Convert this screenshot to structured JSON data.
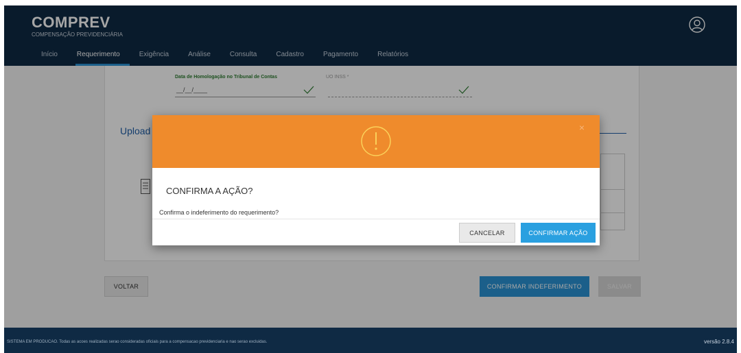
{
  "header": {
    "app_title": "COMPREV",
    "app_subtitle": "COMPENSAÇÃO PREVIDENCIÁRIA",
    "nav": [
      {
        "label": "Início"
      },
      {
        "label": "Requerimento"
      },
      {
        "label": "Exigência"
      },
      {
        "label": "Análise"
      },
      {
        "label": "Consulta"
      },
      {
        "label": "Cadastro"
      },
      {
        "label": "Pagamento"
      },
      {
        "label": "Relatórios"
      }
    ],
    "active_nav": "Requerimento",
    "user_icon": "user-icon"
  },
  "form": {
    "date_label": "Data de Homologação no Tribunal de Contas",
    "date_value": "__/__/____",
    "uo_label": "UO INSS *",
    "upload_title": "Upload"
  },
  "actions": {
    "back_label": "VOLTAR",
    "confirm_reject_label": "CONFIRMAR INDEFERIMENTO",
    "save_label": "SALVAR"
  },
  "modal": {
    "icon": "warning-icon",
    "close_symbol": "×",
    "title": "CONFIRMA A AÇÃO?",
    "message": "Confirma o indeferimento do requerimento?",
    "cancel_label": "CANCELAR",
    "confirm_label": "CONFIRMAR AÇÃO"
  },
  "footer": {
    "notice": "SISTEMA EM PRODUCAO. Todas as acoes realizadas serao consideradas oficiais para a compensacao previdenciaria e nao serao excluidas.",
    "version": "versão 2.8.4"
  },
  "colors": {
    "header_bg": "#0f2a44",
    "accent_blue": "#2a93d5",
    "modal_header": "#ef8b2c",
    "valid_green": "#2e7d32"
  }
}
